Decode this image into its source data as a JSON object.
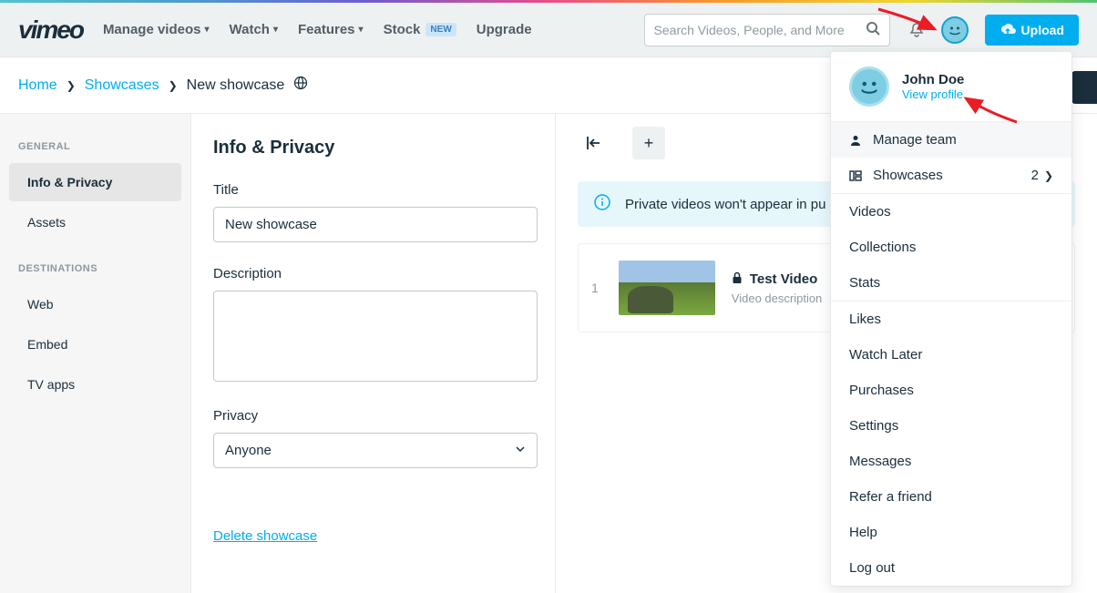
{
  "brand": "vimeo",
  "nav": {
    "manage_videos": "Manage videos",
    "watch": "Watch",
    "features": "Features",
    "stock": "Stock",
    "stock_badge": "NEW",
    "upgrade": "Upgrade"
  },
  "search": {
    "placeholder": "Search Videos, People, and More"
  },
  "upload_label": "Upload",
  "breadcrumb": {
    "home": "Home",
    "showcases": "Showcases",
    "current": "New showcase"
  },
  "sidebar": {
    "heading_general": "GENERAL",
    "items_general": [
      "Info & Privacy",
      "Assets"
    ],
    "heading_destinations": "DESTINATIONS",
    "items_destinations": [
      "Web",
      "Embed",
      "TV apps"
    ]
  },
  "form": {
    "heading": "Info & Privacy",
    "title_label": "Title",
    "title_value": "New showcase",
    "description_label": "Description",
    "description_value": "",
    "privacy_label": "Privacy",
    "privacy_value": "Anyone",
    "delete_label": "Delete showcase"
  },
  "preview": {
    "info_banner": "Private videos won't appear in pu",
    "video": {
      "index": "1",
      "title": "Test Video",
      "description": "Video description"
    }
  },
  "user_menu": {
    "name": "John Doe",
    "view_profile": "View profile",
    "manage_team": "Manage team",
    "showcases": "Showcases",
    "showcases_count": "2",
    "items": [
      "Videos",
      "Collections",
      "Stats",
      "Likes",
      "Watch Later",
      "Purchases",
      "Settings",
      "Messages",
      "Refer a friend",
      "Help",
      "Log out"
    ]
  }
}
